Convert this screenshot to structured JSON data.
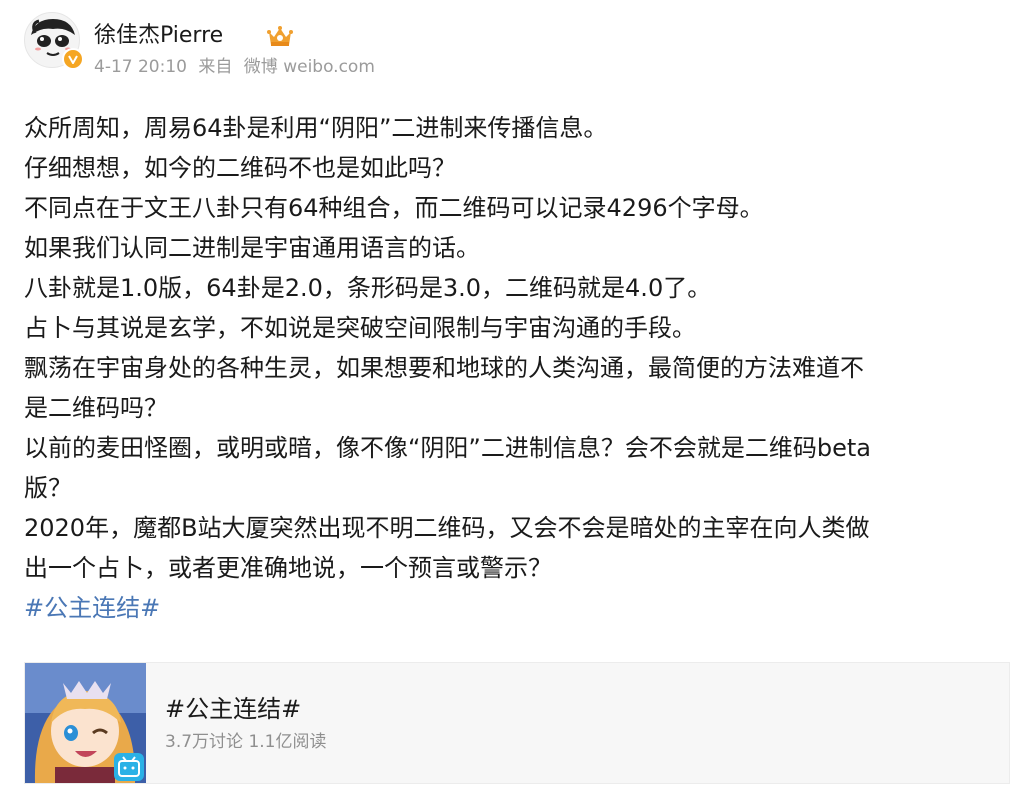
{
  "author": {
    "name": "徐佳杰Pierre",
    "avatar_icon": "cartoon-face-avatar",
    "verified_icon": "verified-v-badge",
    "vip_icon": "crown-vip-icon"
  },
  "post": {
    "date": "4-17 20:10",
    "source_prefix": "来自",
    "source": "微博 weibo.com",
    "body": [
      "众所周知，周易64卦是利用“阴阳”二进制来传播信息。",
      "仔细想想，如今的二维码不也是如此吗？",
      "不同点在于文王八卦只有64种组合，而二维码可以记录4296个字母。",
      "如果我们认同二进制是宇宙通用语言的话。",
      "八卦就是1.0版，64卦是2.0，条形码是3.0，二维码就是4.0了。",
      "占卜与其说是玄学，不如说是突破空间限制与宇宙沟通的手段。",
      "飘荡在宇宙身处的各种生灵，如果想要和地球的人类沟通，最简便的方法难道不",
      "是二维码吗？",
      "以前的麦田怪圈，或明或暗，像不像“阴阳”二进制信息？会不会就是二维码beta",
      "版？",
      "2020年，魔都B站大厦突然出现不明二维码，又会不会是暗处的主宰在向人类做",
      "出一个占卜，或者更准确地说，一个预言或警示？"
    ],
    "hashtag": "#公主连结#"
  },
  "topic_card": {
    "title": "#公主连结#",
    "stats": "3.7万讨论 1.1亿阅读",
    "thumb_icon": "anime-girl-thumbnail",
    "badge_icon": "bilibili-tv-icon"
  },
  "colors": {
    "link": "#4a77b5",
    "meta": "#9b9b9b",
    "card_bg": "#f7f7f7",
    "verified": "#f5a623",
    "bili": "#2ab1e6"
  }
}
